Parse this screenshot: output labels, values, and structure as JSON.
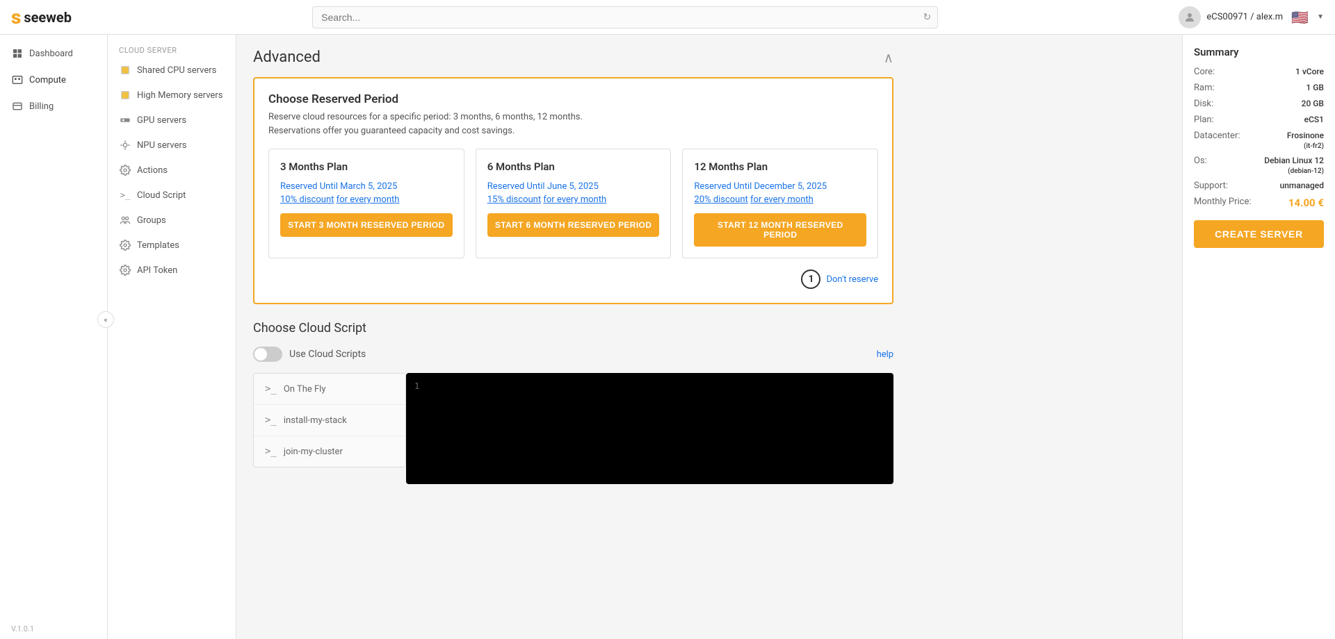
{
  "topbar": {
    "logo": "seeweb",
    "logo_s": "s",
    "search_placeholder": "Search...",
    "user_name": "eCS00971 / alex.m",
    "flag": "🇺🇸"
  },
  "sidebar": {
    "items": [
      {
        "id": "dashboard",
        "label": "Dashboard",
        "icon": "⊞"
      },
      {
        "id": "compute",
        "label": "Compute",
        "icon": "▦",
        "active": true
      },
      {
        "id": "billing",
        "label": "Billing",
        "icon": "☰"
      }
    ],
    "version": "V.1.0.1",
    "collapse_label": "«"
  },
  "sub_sidebar": {
    "section_label": "CLOUD SERVER",
    "items": [
      {
        "id": "shared-cpu",
        "label": "Shared CPU servers",
        "icon": "🟡"
      },
      {
        "id": "high-memory",
        "label": "High Memory servers",
        "icon": "🟡"
      },
      {
        "id": "gpu-servers",
        "label": "GPU servers",
        "icon": "📷"
      },
      {
        "id": "npu-servers",
        "label": "NPU servers",
        "icon": "⚙"
      },
      {
        "id": "actions",
        "label": "Actions",
        "icon": "⚙"
      },
      {
        "id": "cloud-script",
        "label": "Cloud Script",
        "icon": ">_"
      },
      {
        "id": "groups",
        "label": "Groups",
        "icon": "👥"
      },
      {
        "id": "templates",
        "label": "Templates",
        "icon": "⚙"
      },
      {
        "id": "api-token",
        "label": "API Token",
        "icon": "⚙"
      }
    ]
  },
  "summary": {
    "title": "Summary",
    "rows": [
      {
        "label": "Core:",
        "value": "1 vCore"
      },
      {
        "label": "Ram:",
        "value": "1 GB"
      },
      {
        "label": "Disk:",
        "value": "20 GB"
      },
      {
        "label": "Plan:",
        "value": "eCS1"
      },
      {
        "label": "Datacenter:",
        "value": "Frosinone\n(it-fr2)"
      },
      {
        "label": "Os:",
        "value": "Debian Linux 12\n(debian-12)"
      },
      {
        "label": "Support:",
        "value": "unmanaged"
      },
      {
        "label": "Monthly Price:",
        "value": "14.00 €"
      }
    ],
    "create_button": "CREATE SERVER"
  },
  "advanced": {
    "title": "Advanced",
    "reserved_period": {
      "title": "Choose Reserved Period",
      "description_line1": "Reserve cloud resources for a specific period: 3 months, 6 months, 12 months.",
      "description_line2": "Reservations offer you guaranteed capacity and cost savings.",
      "plans": [
        {
          "name": "3 Months Plan",
          "until_label": "Reserved Until",
          "until_date": "March 5, 2025",
          "discount_label": "10% discount",
          "discount_suffix": "for every month",
          "button": "START 3 MONTH RESERVED PERIOD"
        },
        {
          "name": "6 Months Plan",
          "until_label": "Reserved Until",
          "until_date": "June 5, 2025",
          "discount_label": "15% discount",
          "discount_suffix": "for every month",
          "button": "START 6 MONTH RESERVED PERIOD"
        },
        {
          "name": "12 Months Plan",
          "until_label": "Reserved Until",
          "until_date": "December 5, 2025",
          "discount_label": "20% discount",
          "discount_suffix": "for every month",
          "button": "START 12 MONTH RESERVED PERIOD"
        }
      ],
      "dont_reserve": "Don't reserve",
      "step_number": "1"
    },
    "cloud_script": {
      "title": "Choose Cloud Script",
      "toggle_label": "Use Cloud Scripts",
      "help_link": "help",
      "scripts": [
        {
          "prompt": ">_",
          "name": "On The Fly"
        },
        {
          "prompt": ">_",
          "name": "install-my-stack"
        },
        {
          "prompt": ">_",
          "name": "join-my-cluster"
        }
      ],
      "editor_line_number": "1"
    }
  }
}
